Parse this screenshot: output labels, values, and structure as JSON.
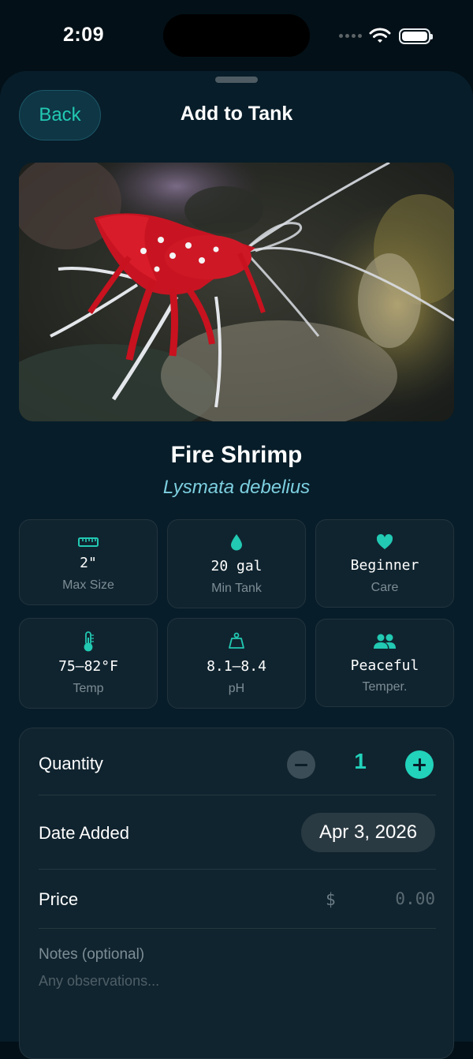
{
  "status_bar": {
    "time": "2:09"
  },
  "header": {
    "back_label": "Back",
    "title": "Add to Tank"
  },
  "species": {
    "common_name": "Fire Shrimp",
    "scientific_name": "Lysmata debelius"
  },
  "stats": [
    {
      "icon": "ruler-icon",
      "value": "2\"",
      "label": "Max Size"
    },
    {
      "icon": "water-drop-icon",
      "value": "20 gal",
      "label": "Min Tank"
    },
    {
      "icon": "heart-icon",
      "value": "Beginner",
      "label": "Care"
    },
    {
      "icon": "thermometer-icon",
      "value": "75–82°F",
      "label": "Temp"
    },
    {
      "icon": "scale-icon",
      "value": "8.1–8.4",
      "label": "pH"
    },
    {
      "icon": "people-icon",
      "value": "Peaceful",
      "label": "Temper."
    }
  ],
  "form": {
    "quantity_label": "Quantity",
    "quantity_value": "1",
    "date_label": "Date Added",
    "date_value": "Apr 3, 2026",
    "price_label": "Price",
    "currency_symbol": "$",
    "price_placeholder": "0.00",
    "notes_label": "Notes (optional)",
    "notes_placeholder": "Any observations..."
  },
  "colors": {
    "accent": "#22d2bb",
    "background": "#071d29",
    "card": "#10242f",
    "subtitle": "#7dcfe0"
  }
}
